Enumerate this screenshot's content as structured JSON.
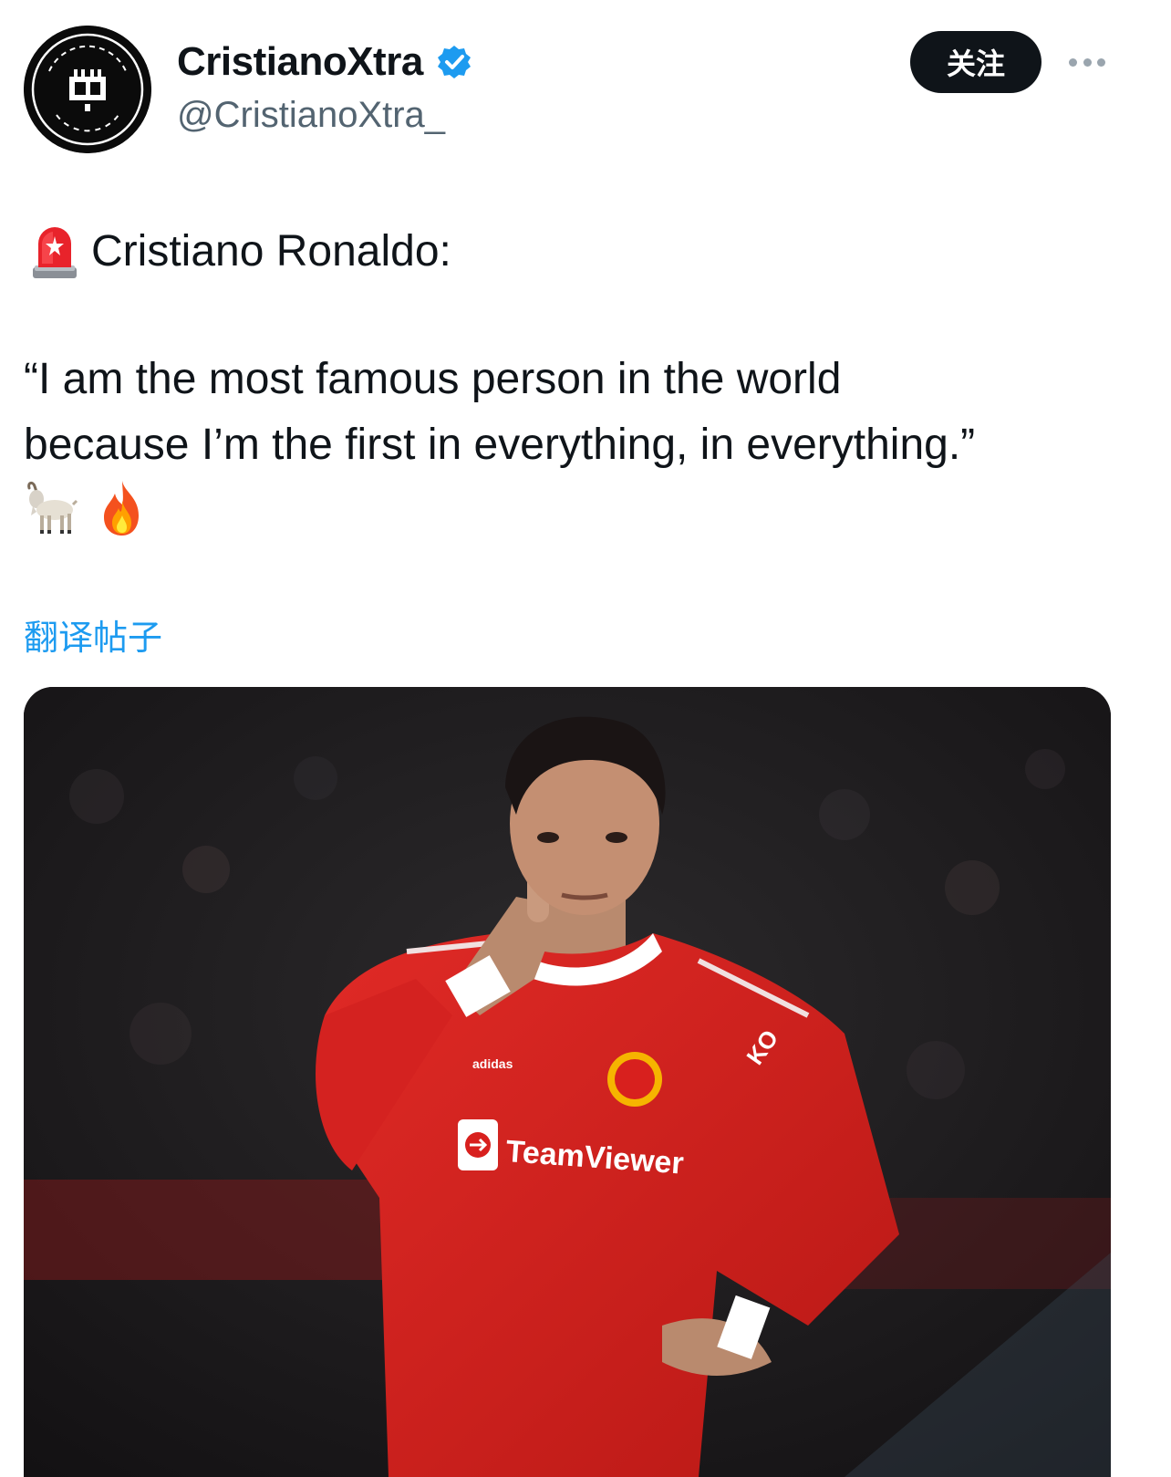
{
  "account": {
    "display_name": "CristianoXtra",
    "handle": "@CristianoXtra_",
    "verified": true,
    "avatar_icon": "cristianoxtra-logo-icon",
    "follow_label": "关注",
    "more_icon": "more-dots-icon"
  },
  "tweet": {
    "title_emoji": "police-car-light-icon",
    "title_text": "Cristiano Ronaldo:",
    "quote_line_1": "“I am the most famous person in the world",
    "quote_line_2": "because I’m  the first in everything, in everything.”",
    "emojis": [
      "goat-icon",
      "fire-icon"
    ],
    "translate_label": "翻译帖子"
  },
  "media": {
    "description_icon": "photo-player-shushing-gesture",
    "jersey_sponsor": "TeamViewer",
    "sleeve_text": "KO"
  },
  "colors": {
    "link": "#1d9bf0",
    "verified_badge": "#1d9bf0",
    "text_primary": "#0f1419",
    "text_secondary": "#536471",
    "follow_button_bg": "#0f1419",
    "jersey_red": "#d6201f"
  }
}
